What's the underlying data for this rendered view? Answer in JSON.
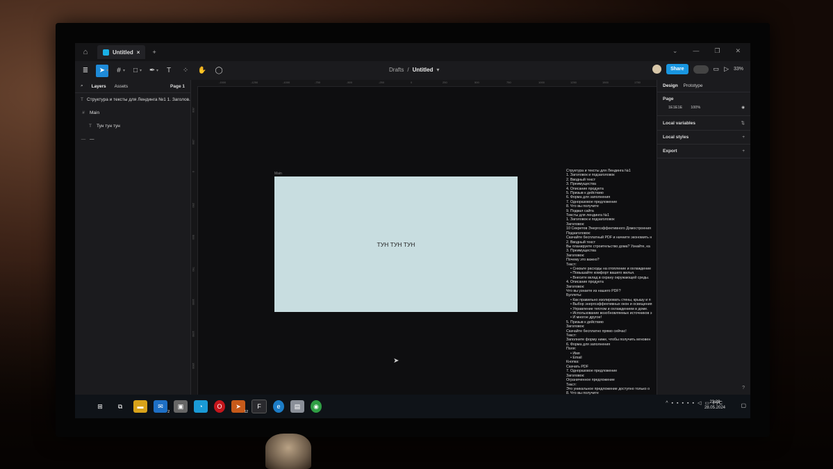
{
  "app": {
    "tab_title": "Untitled",
    "new_tab": "+",
    "close_tab": "×"
  },
  "toolbar": {
    "breadcrumb_project": "Drafts",
    "breadcrumb_sep": "/",
    "breadcrumb_file": "Untitled",
    "share_label": "Share",
    "zoom": "33%"
  },
  "left_panel": {
    "tabs": [
      "Layers",
      "Assets"
    ],
    "page": "Page 1",
    "layers": [
      {
        "icon": "text-icon",
        "label": "Структура и тексты для Лендинга №1 1. Заголов...",
        "indent": false
      },
      {
        "icon": "frame-icon",
        "label": "Main",
        "indent": false
      },
      {
        "icon": "text-icon",
        "label": "Тун тун тун",
        "indent": true
      },
      {
        "icon": "line-icon",
        "label": "—",
        "indent": false
      }
    ]
  },
  "canvas": {
    "frame_label": "Main",
    "frame_text": "ТУН ТУН ТУН",
    "frame_color": "#C8DDE0",
    "ruler_top": [
      "-1500",
      "-1250",
      "-1000",
      "-750",
      "-500",
      "-250",
      "0",
      "250",
      "500",
      "750",
      "1000",
      "1250",
      "1500",
      "1750"
    ],
    "ruler_left": [
      "-500",
      "-250",
      "0",
      "250",
      "500",
      "750",
      "1000",
      "1250",
      "1500"
    ],
    "doc_lines": [
      {
        "t": "Структура и тексты для Лендинга №1",
        "b": false
      },
      {
        "t": "1. Заголовок и подзаголовок",
        "b": false
      },
      {
        "t": "2. Вводный текст",
        "b": false
      },
      {
        "t": "3. Преимущества",
        "b": false
      },
      {
        "t": "4. Описание продукта",
        "b": false
      },
      {
        "t": "5. Призыв к действию",
        "b": false
      },
      {
        "t": "6. Форма для заполнения",
        "b": false
      },
      {
        "t": "7. Одноразовое предложение",
        "b": false
      },
      {
        "t": "8. Что вы получите",
        "b": false
      },
      {
        "t": "9. Подвал сайта",
        "b": false
      },
      {
        "t": "Тексты для лендинга №1",
        "b": false
      },
      {
        "t": "1. Заголовок и подзаголовок",
        "b": false
      },
      {
        "t": "Заголовок:",
        "b": false
      },
      {
        "t": "10 Секретов Энергоэффективного Домостроения",
        "b": false
      },
      {
        "t": "Подзаголовок:",
        "b": false
      },
      {
        "t": "Скачайте бесплатный PDF и начните экономить н",
        "b": false
      },
      {
        "t": "2. Вводный текст",
        "b": false
      },
      {
        "t": "Вы планируете строительство дома? Узнайте, ка",
        "b": false
      },
      {
        "t": "3. Преимущества",
        "b": false
      },
      {
        "t": "Заголовок:",
        "b": false
      },
      {
        "t": "Почему это важно?",
        "b": false
      },
      {
        "t": "Текст:",
        "b": false
      },
      {
        "t": "Снизьте расходы на отопление и охлаждение",
        "b": true
      },
      {
        "t": "Повышайте комфорт вашего жилья.",
        "b": true
      },
      {
        "t": "Внесите вклад в охрану окружающей среды.",
        "b": true
      },
      {
        "t": "4. Описание продукта",
        "b": false
      },
      {
        "t": "Заголовок:",
        "b": false
      },
      {
        "t": "Что вы узнаете из нашего PDF?",
        "b": false
      },
      {
        "t": "Буллеты:",
        "b": false
      },
      {
        "t": "Как правильно изолировать стены, крышу и п",
        "b": true
      },
      {
        "t": "Выбор энергоэффективных окон и освещения",
        "b": true
      },
      {
        "t": "Управление теплом и охлаждением в доме.",
        "b": true
      },
      {
        "t": "Использование возобновляемых источников э",
        "b": true
      },
      {
        "t": "И многое другое!",
        "b": true
      },
      {
        "t": "5. Призыв к действию",
        "b": false
      },
      {
        "t": "Заголовок:",
        "b": false
      },
      {
        "t": "Скачайте бесплатно прямо сейчас!",
        "b": false
      },
      {
        "t": "Текст:",
        "b": false
      },
      {
        "t": "Заполните форму ниже, чтобы получить мгновен",
        "b": false
      },
      {
        "t": "6. Форма для заполнения",
        "b": false
      },
      {
        "t": "Поля:",
        "b": false
      },
      {
        "t": "Имя",
        "b": true
      },
      {
        "t": "Email",
        "b": true
      },
      {
        "t": "Кнопка:",
        "b": false
      },
      {
        "t": "Скачать PDF",
        "b": false
      },
      {
        "t": "7. Одноразовое предложение",
        "b": false
      },
      {
        "t": "Заголовок:",
        "b": false
      },
      {
        "t": "Ограниченное предложение",
        "b": false
      },
      {
        "t": "Текст:",
        "b": false
      },
      {
        "t": "Это уникальное предложение доступно только о",
        "b": false
      },
      {
        "t": "8. Что вы получите",
        "b": false
      }
    ]
  },
  "right_panel": {
    "tabs": [
      "Design",
      "Prototype"
    ],
    "page_section": "Page",
    "page_color": "1E1E1E",
    "page_opacity": "100%",
    "local_variables": "Local variables",
    "local_styles": "Local styles",
    "export": "Export",
    "help": "?"
  },
  "taskbar": {
    "lang": "РУС",
    "time": "23:29",
    "date": "28.05.2024",
    "mail_badge": "2",
    "telegram_badge": "12"
  }
}
